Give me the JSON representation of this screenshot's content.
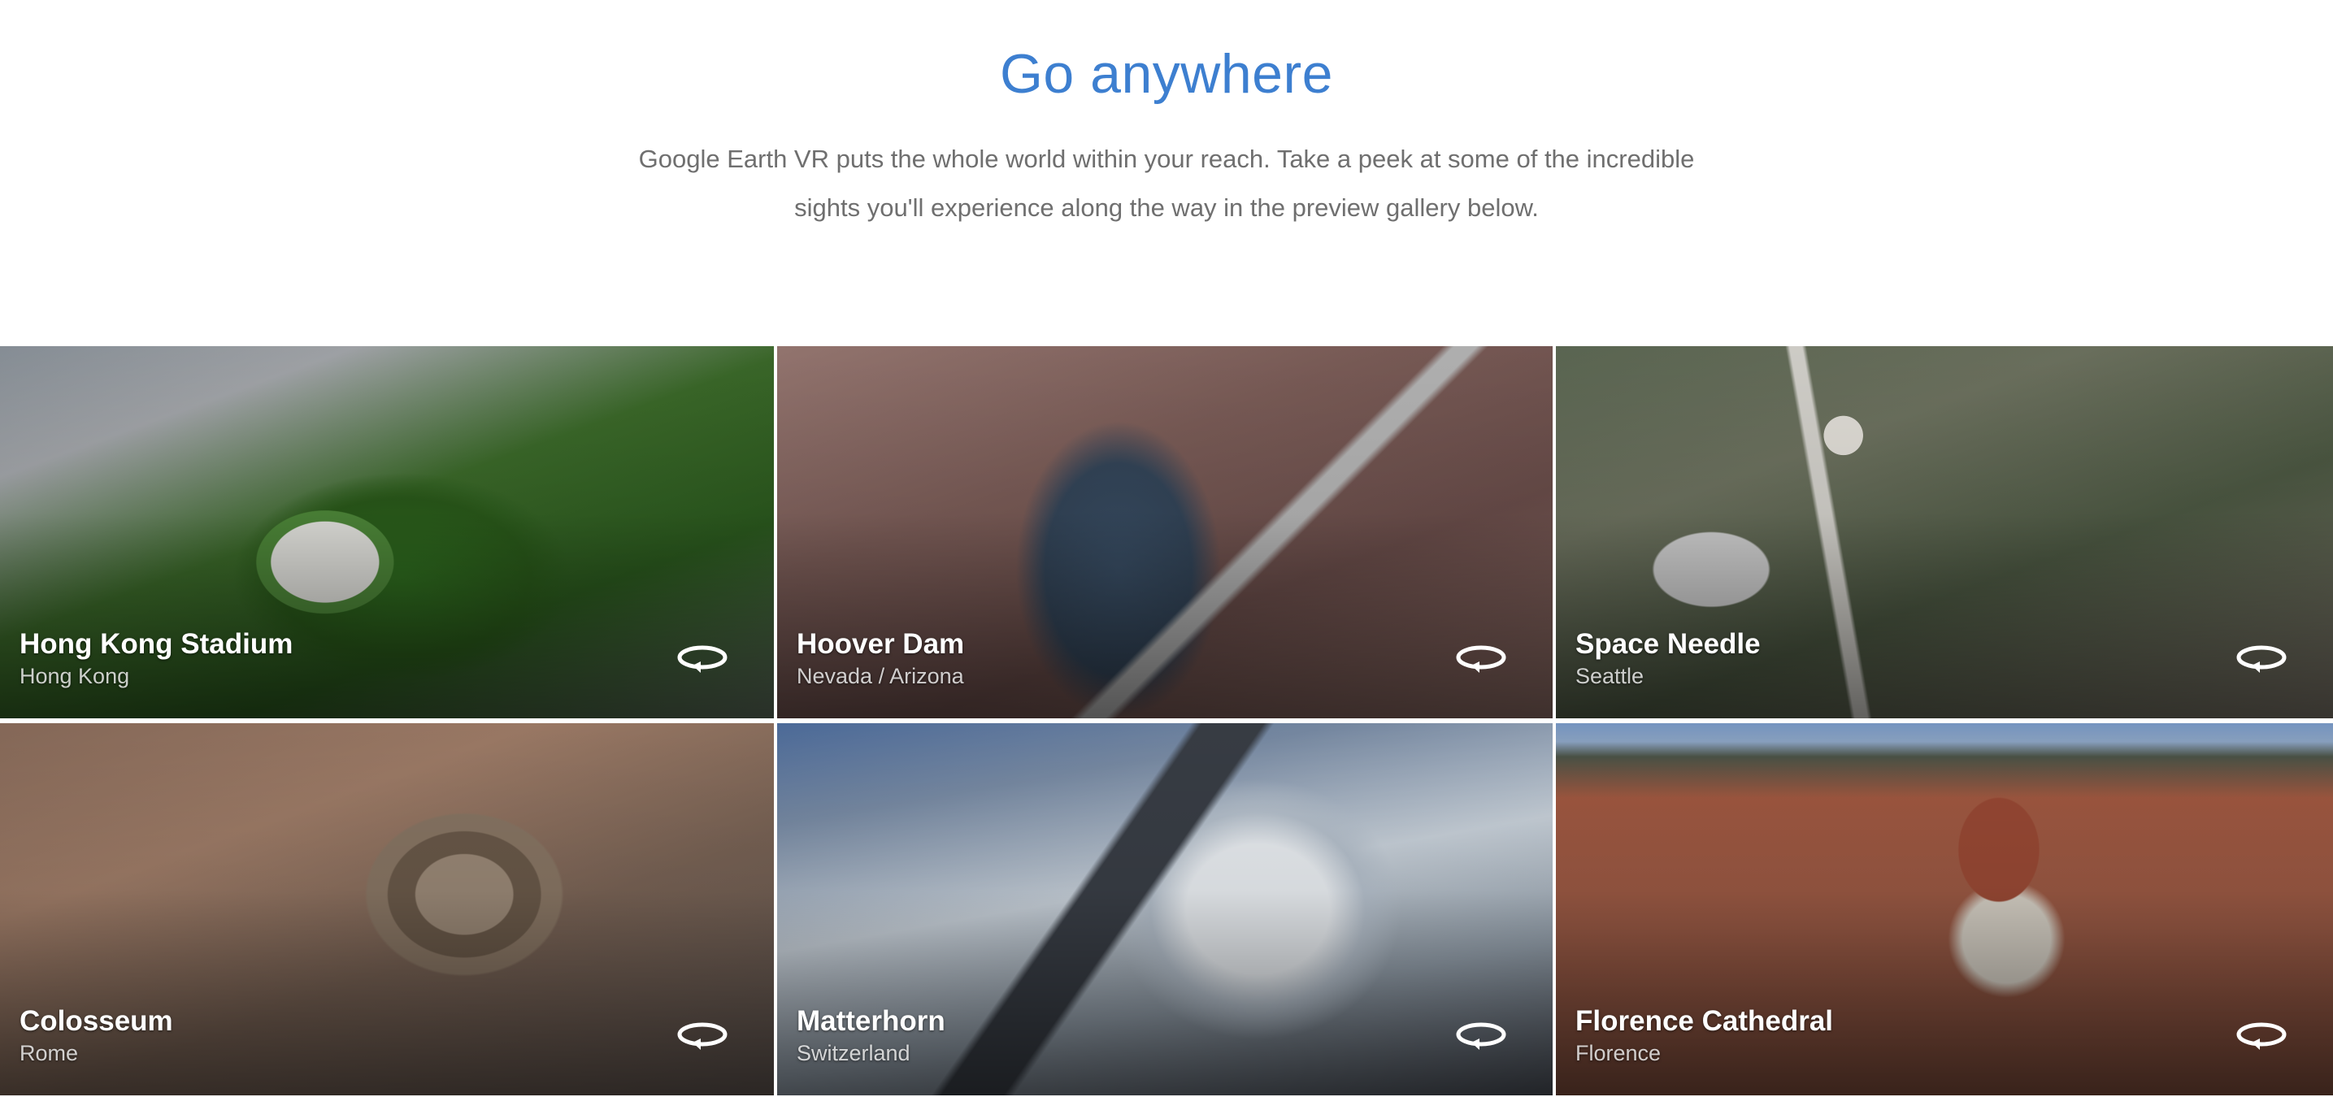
{
  "section": {
    "title": "Go anywhere",
    "description": "Google Earth VR puts the whole world within your reach. Take a peek at some of the incredible sights you'll experience along the way in the preview gallery below."
  },
  "gallery": {
    "items": [
      {
        "title": "Hong Kong Stadium",
        "subtitle": "Hong Kong",
        "icon": "rotate-360-icon"
      },
      {
        "title": "Hoover Dam",
        "subtitle": "Nevada / Arizona",
        "icon": "rotate-360-icon"
      },
      {
        "title": "Space Needle",
        "subtitle": "Seattle",
        "icon": "rotate-360-icon"
      },
      {
        "title": "Colosseum",
        "subtitle": "Rome",
        "icon": "rotate-360-icon"
      },
      {
        "title": "Matterhorn",
        "subtitle": "Switzerland",
        "icon": "rotate-360-icon"
      },
      {
        "title": "Florence Cathedral",
        "subtitle": "Florence",
        "icon": "rotate-360-icon"
      }
    ]
  },
  "colors": {
    "title": "#3d7fd0",
    "body_text": "#6f6f6f",
    "caption_text": "#ffffff"
  }
}
